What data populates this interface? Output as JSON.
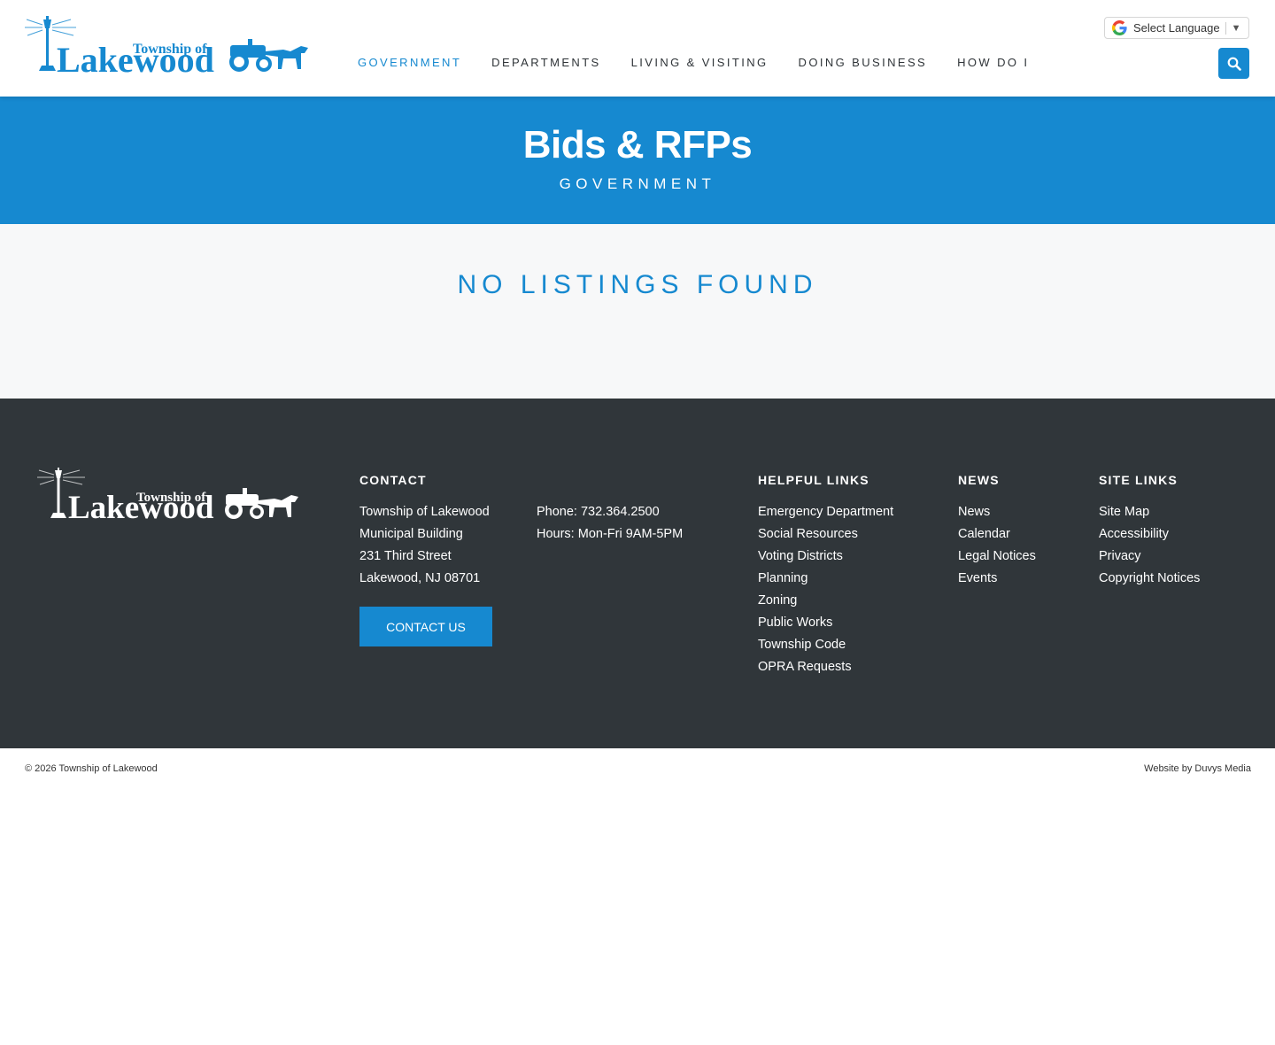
{
  "header": {
    "logo": {
      "small_text": "Township of",
      "big_text": "Lakewood"
    },
    "nav": [
      {
        "label": "GOVERNMENT",
        "active": true
      },
      {
        "label": "DEPARTMENTS",
        "active": false
      },
      {
        "label": "LIVING & VISITING",
        "active": false
      },
      {
        "label": "DOING BUSINESS",
        "active": false
      },
      {
        "label": "HOW DO I",
        "active": false
      }
    ],
    "language": {
      "label": "Select Language",
      "arrow": "▼"
    },
    "search": {
      "icon": "search-icon"
    }
  },
  "hero": {
    "title": "Bids & RFPs",
    "subtitle": "GOVERNMENT"
  },
  "main": {
    "empty_message": "NO LISTINGS FOUND"
  },
  "footer": {
    "logo": {
      "small_text": "Township of",
      "big_text": "Lakewood"
    },
    "contact": {
      "heading": "CONTACT",
      "address": [
        "Township of Lakewood",
        "Municipal Building",
        "231 Third Street",
        "Lakewood, NJ 08701"
      ],
      "details": [
        "Phone: 732.364.2500",
        "Hours: Mon-Fri 9AM-5PM"
      ],
      "button_label": "CONTACT US"
    },
    "helpful_links": {
      "heading": "HELPFUL LINKS",
      "items": [
        "Emergency Department",
        "Social Resources",
        "Voting Districts",
        "Planning",
        "Zoning",
        "Public Works",
        "Township Code",
        "OPRA Requests"
      ]
    },
    "news": {
      "heading": "NEWS",
      "items": [
        "News",
        "Calendar",
        "Legal Notices",
        "Events"
      ]
    },
    "site_links": {
      "heading": "SITE LINKS",
      "items": [
        "Site Map",
        "Accessibility",
        "Privacy",
        "Copyright Notices"
      ]
    }
  },
  "bottom": {
    "copyright": "© 2026 Township of Lakewood",
    "credit": "Website by Duvys Media"
  },
  "colors": {
    "brand_blue": "#1689d0",
    "footer_bg": "#30363a",
    "main_bg": "#f7f8f9"
  }
}
